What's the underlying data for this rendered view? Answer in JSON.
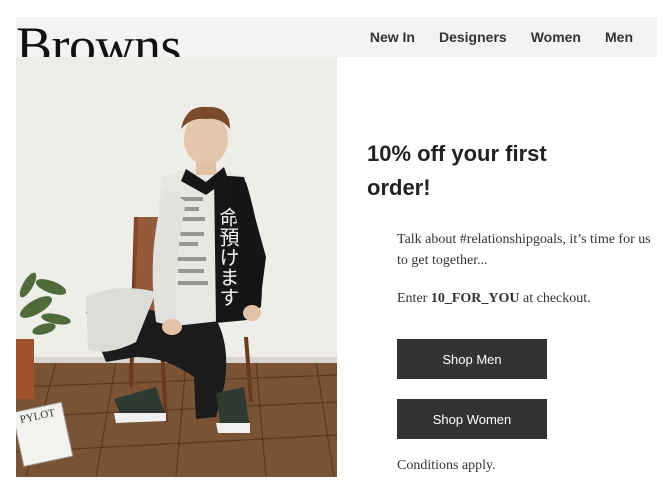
{
  "header": {
    "logo_text": "Browns",
    "nav": [
      "New In",
      "Designers",
      "Women",
      "Men"
    ]
  },
  "hero": {
    "shirt_text": "命預けます",
    "magazine_text": "PYLOT"
  },
  "promo": {
    "title": "10% off your first order!",
    "body": "Talk about #relationshipgoals, it’s time for us to get together...",
    "code_prefix": "Enter ",
    "code": "10_FOR_YOU",
    "code_suffix": " at checkout.",
    "shop_men": "Shop Men",
    "shop_women": "Shop Women",
    "conditions": "Conditions apply."
  },
  "colors": {
    "button_bg": "#333333",
    "header_bg": "#f3f3f3"
  }
}
